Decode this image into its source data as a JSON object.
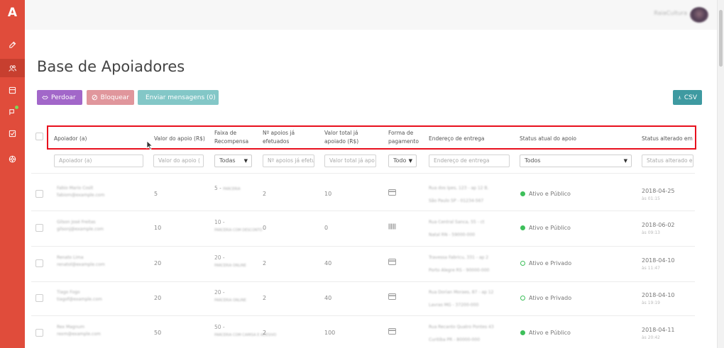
{
  "app": {
    "logo": "A",
    "username": "RaiaCultura"
  },
  "sidebar": {
    "items": [
      {
        "icon": "edit-icon"
      },
      {
        "icon": "users-icon",
        "active": true
      },
      {
        "icon": "box-icon"
      },
      {
        "icon": "flag-icon",
        "badge": true
      },
      {
        "icon": "checkbox-icon"
      },
      {
        "icon": "globe-icon"
      }
    ]
  },
  "page": {
    "title": "Base de Apoiadores"
  },
  "toolbar": {
    "perdoar": "Perdoar",
    "bloquear": "Bloquear",
    "enviar": "Enviar mensagens (0)",
    "csv": "CSV"
  },
  "table": {
    "headers": {
      "apoiador": "Apoiador (a)",
      "valor": "Valor do apoio (R$)",
      "faixa": "Faixa de Recompensa",
      "napoios": "Nº apoios já efetuados",
      "valortotal": "Valor total já apoiado (R$)",
      "forma": "Forma de pagamento",
      "endereco": "Endereço de entrega",
      "status": "Status atual do apoio",
      "alterado": "Status alterado em"
    },
    "filters": {
      "apoiador": "Apoiador (a)",
      "valor": "Valor do apoio (",
      "faixa": "Todas",
      "napoios": "Nº apoios já efetu",
      "valortotal": "Valor total já apo",
      "forma": "Todo",
      "endereco": "Endereço de entrega",
      "status": "Todos",
      "alterado": "Status alterado e"
    },
    "rows": [
      {
        "name": "Fabio Mario Coslt",
        "email": "fabiom@example.com",
        "valor": "5",
        "faixa": "5 - ",
        "faixa_desc": "PARCERIA",
        "napoios": "2",
        "total": "10",
        "pay": "card",
        "addr": "Rua dos Ipes, 123 - ap 12\nB.",
        "addr2": "São Paulo SP - 01234-567",
        "status": "Ativo e Público",
        "status_type": "filled",
        "date": "2018-04-25",
        "time": "às 01:15"
      },
      {
        "name": "Gilson José Freitas",
        "email": "gilsonj@example.com",
        "valor": "10",
        "faixa": "10 - ",
        "faixa_desc": "PARCERIA COM DESCONTO",
        "napoios": "0",
        "total": "0",
        "pay": "barcode",
        "addr": "Rua Central Sanca, 55 - ct",
        "addr2": "Natal RN - 59000-000",
        "status": "Ativo e Público",
        "status_type": "filled",
        "date": "2018-06-02",
        "time": "às 09:13"
      },
      {
        "name": "Renato Lima",
        "email": "renatol@example.com",
        "valor": "20",
        "faixa": "20 - ",
        "faixa_desc": "PARCERIA ONLINE",
        "napoios": "2",
        "total": "40",
        "pay": "card",
        "addr": "Travessa Fabricu, 331 - ap 2",
        "addr2": "Porto Alegre RS - 90000-000",
        "status": "Ativo e Privado",
        "status_type": "hollow",
        "date": "2018-04-10",
        "time": "às 11:47"
      },
      {
        "name": "Tiago Fogo",
        "email": "tiagof@example.com",
        "valor": "20",
        "faixa": "20 - ",
        "faixa_desc": "PARCERIA ONLINE",
        "napoios": "2",
        "total": "40",
        "pay": "card",
        "addr": "Rua Dorian Moraes, 87 - ap 12",
        "addr2": "Lavras MG - 37200-000",
        "status": "Ativo e Privado",
        "status_type": "hollow",
        "date": "2018-04-10",
        "time": "às 19:19"
      },
      {
        "name": "Rex Magnum",
        "email": "rexm@example.com",
        "valor": "50",
        "faixa": "50 - ",
        "faixa_desc": "PARCERIA COM CAMISA E ADESIVO",
        "napoios": "2",
        "total": "100",
        "pay": "card",
        "addr": "Rua Recanto Quatro Pontes 43",
        "addr2": "Curitiba PR - 80000-000",
        "status": "Ativo e Público",
        "status_type": "filled",
        "date": "2018-04-11",
        "time": "às 20:42"
      }
    ]
  }
}
